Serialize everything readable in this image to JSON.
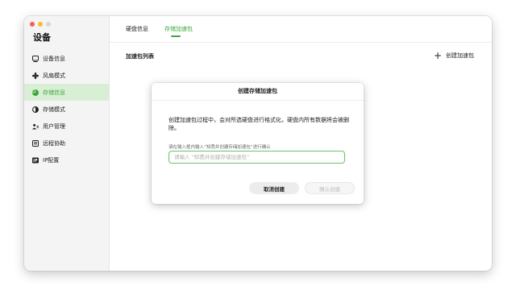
{
  "app": {
    "title": "设备"
  },
  "sidebar": {
    "items": [
      {
        "label": "设备信息",
        "icon": "device-info-icon",
        "active": false
      },
      {
        "label": "风扇模式",
        "icon": "fan-icon",
        "active": false
      },
      {
        "label": "存储信息",
        "icon": "storage-icon",
        "active": true
      },
      {
        "label": "存储模式",
        "icon": "storage-mode-icon",
        "active": false
      },
      {
        "label": "用户管理",
        "icon": "users-icon",
        "active": false
      },
      {
        "label": "远程协助",
        "icon": "remote-icon",
        "active": false
      },
      {
        "label": "IP配置",
        "icon": "ip-icon",
        "active": false
      }
    ]
  },
  "tabs": [
    {
      "label": "硬盘信息",
      "active": false
    },
    {
      "label": "存储加速包",
      "active": true
    }
  ],
  "main": {
    "section_title": "加速包列表",
    "create_label": "创建加速包"
  },
  "dialog": {
    "title": "创建存储加速包",
    "message": "创建加速包过程中，会对所选硬盘进行格式化，硬盘内所有数据将会被删除。",
    "hint": "请在输入框内输入“知悉并创建存储加速包”进行确认",
    "input_placeholder": "请输入 “知悉并创建存储加速包”",
    "input_value": "",
    "cancel_label": "取消创建",
    "confirm_label": "确认创建"
  },
  "colors": {
    "accent": "#3da73d",
    "active_bg": "#d8efd6"
  }
}
